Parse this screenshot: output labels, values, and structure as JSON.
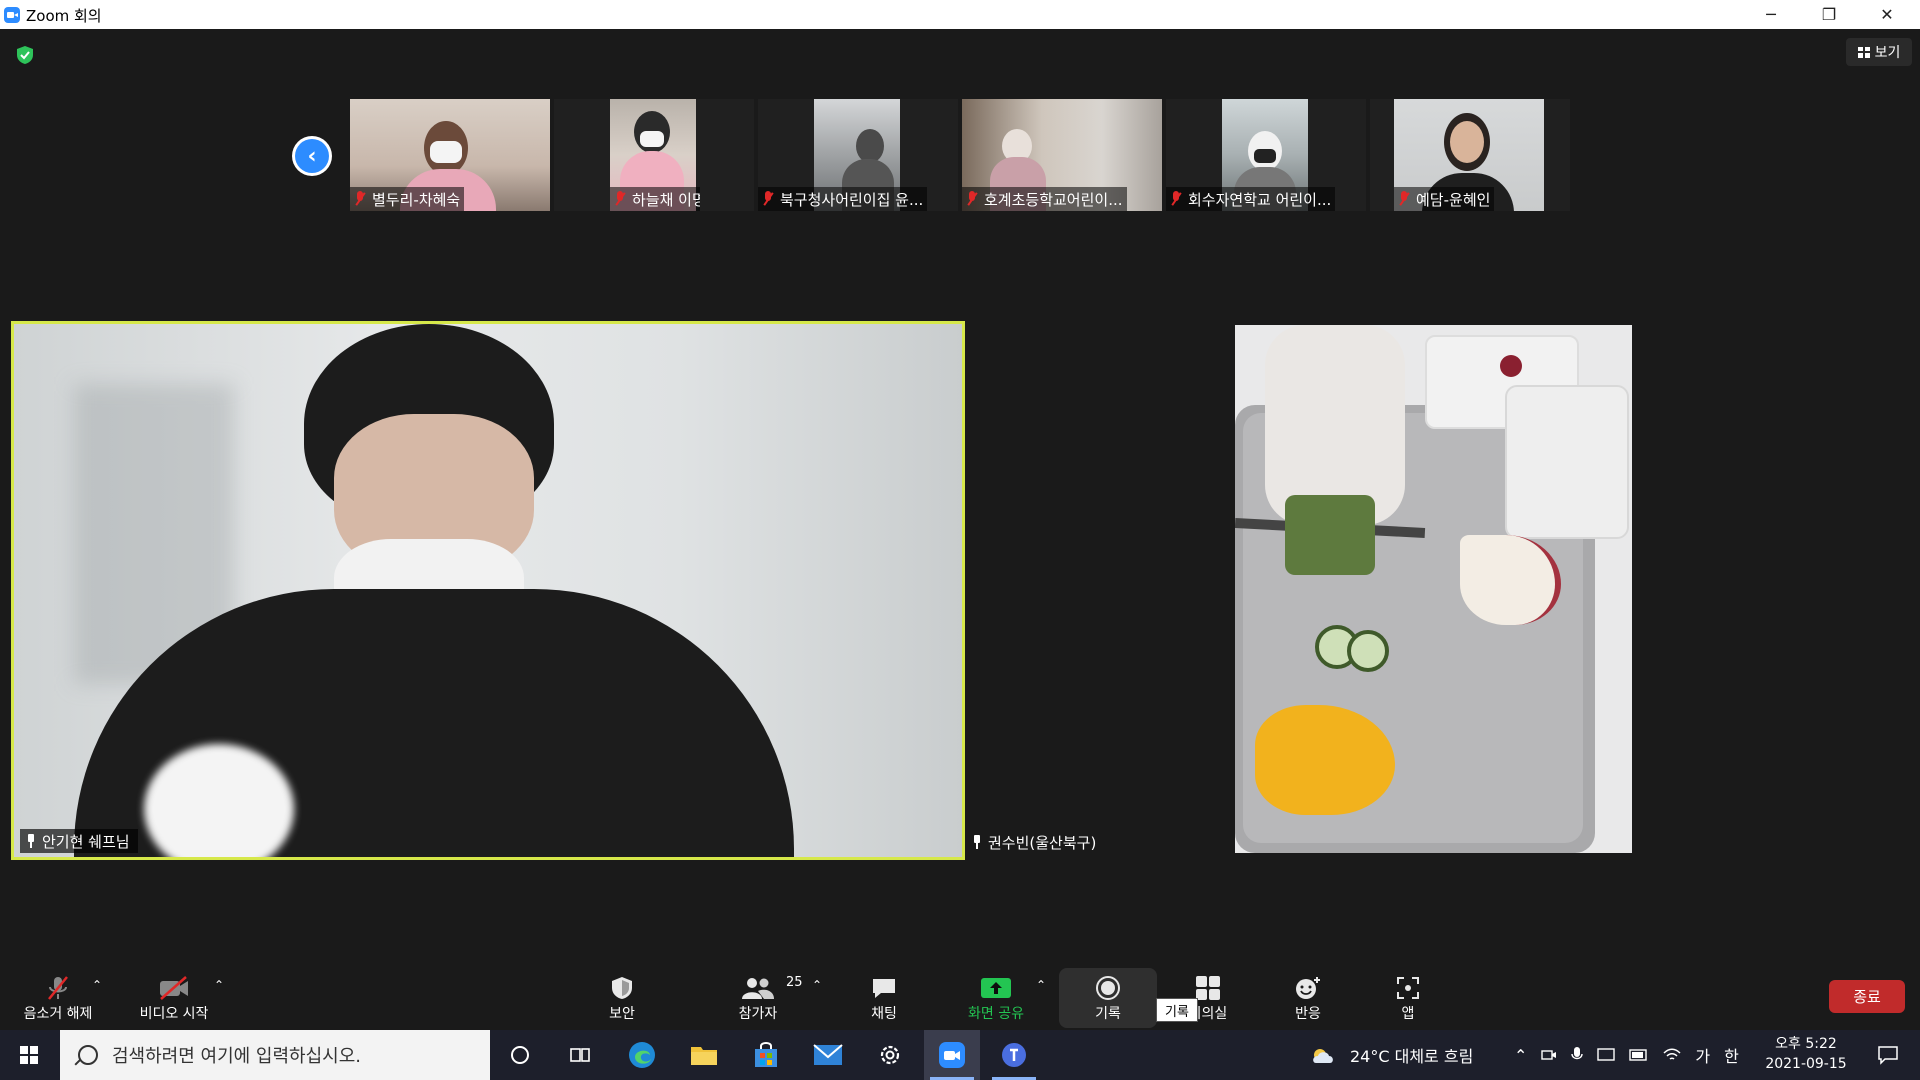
{
  "window": {
    "title": "Zoom 회의",
    "controls": {
      "minimize": "─",
      "restore": "❐",
      "close": "✕"
    }
  },
  "header": {
    "view_label": "보기",
    "security_shield_color": "#2ec35a"
  },
  "strip": {
    "nav_icon": "chevron-left-icon",
    "participants": [
      {
        "name": "별두리-차혜숙",
        "muted": true
      },
      {
        "name": "하늘채  이명화",
        "muted": true
      },
      {
        "name": "북구청사어린이집 윤...",
        "muted": true
      },
      {
        "name": "호계초등학교어린이...",
        "muted": true
      },
      {
        "name": "회수자연학교 어린이...",
        "muted": true
      },
      {
        "name": "예담-윤혜인",
        "muted": true
      }
    ]
  },
  "main": {
    "left_name": "안기현 쉐프님",
    "right_name": "권수빈(울산북구)",
    "active_speaker_border": "#d6e84a"
  },
  "toolbar": {
    "mute_label": "음소거 해제",
    "video_label": "비디오 시작",
    "security_label": "보안",
    "participants_label": "참가자",
    "participants_count": "25",
    "chat_label": "채팅",
    "share_label": "화면 공유",
    "record_label": "기록",
    "record_tooltip": "기록",
    "breakout_label": "회의실",
    "reactions_label": "반응",
    "apps_label": "앱",
    "end_label": "종료",
    "share_color": "#23c552",
    "end_color": "#c12b2b"
  },
  "taskbar": {
    "search_placeholder": "검색하려면 여기에 입력하십시오.",
    "weather": "24°C  대체로 흐림",
    "ime_1": "가",
    "ime_2": "한",
    "time": "오후 5:22",
    "date": "2021-09-15"
  }
}
